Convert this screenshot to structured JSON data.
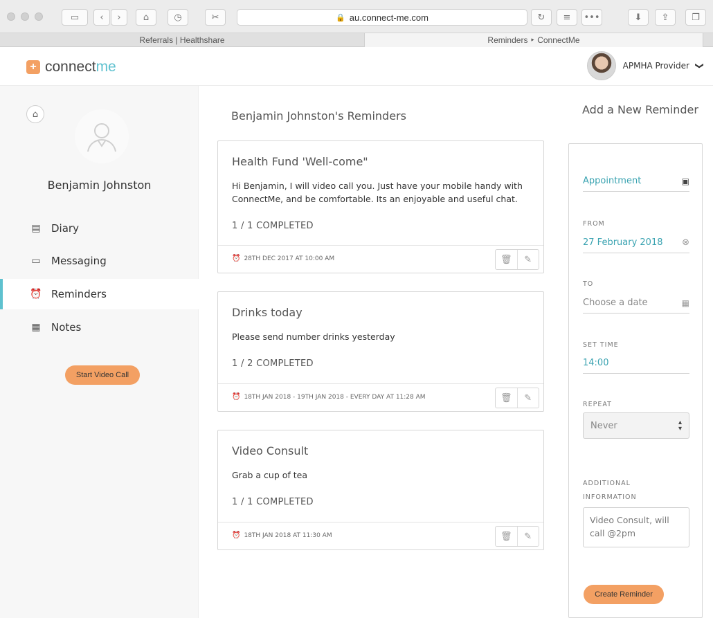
{
  "browser": {
    "url": "au.connect-me.com",
    "lock_icon": "lock-icon",
    "tabs": [
      {
        "label": "Referrals | Healthshare",
        "active": false
      },
      {
        "label": "Reminders ‣ ConnectMe",
        "active": true
      }
    ]
  },
  "header": {
    "logo_word1": "connect",
    "logo_word2": "me",
    "logo_symbol": "+",
    "user_name": "APMHA Provider",
    "chevron": "❯"
  },
  "sidebar": {
    "patient_name": "Benjamin Johnston",
    "items": [
      {
        "label": "Diary",
        "icon": "diary-icon"
      },
      {
        "label": "Messaging",
        "icon": "messaging-icon"
      },
      {
        "label": "Reminders",
        "icon": "alarm-clock-icon"
      },
      {
        "label": "Notes",
        "icon": "notes-icon"
      }
    ],
    "video_call_label": "Start Video Call"
  },
  "main": {
    "title": "Benjamin Johnston's Reminders",
    "reminders": [
      {
        "title": "Health Fund 'Well-come\"",
        "body": "Hi Benjamin, I will video call you. Just have your mobile handy with ConnectMe, and be comfortable. Its an enjoyable and useful chat.",
        "status": "1 / 1 COMPLETED",
        "schedule": "28TH DEC 2017 AT 10:00 AM"
      },
      {
        "title": "Drinks today",
        "body": "Please send number drinks yesterday",
        "status": "1 / 2 COMPLETED",
        "schedule": "18TH JAN 2018 - 19TH JAN 2018 - EVERY DAY AT 11:28 AM"
      },
      {
        "title": "Video Consult",
        "body": "Grab a cup of tea",
        "status": "1 / 1 COMPLETED",
        "schedule": "18TH JAN 2018 AT 11:30 AM"
      }
    ]
  },
  "form": {
    "title": "Add a New Reminder",
    "type_value": "Appointment",
    "from_label": "FROM",
    "from_value": "27 February 2018",
    "to_label": "TO",
    "to_placeholder": "Choose a date",
    "time_label": "SET TIME",
    "time_value": "14:00",
    "repeat_label": "REPEAT",
    "repeat_value": "Never",
    "info_label_line1": "ADDITIONAL",
    "info_label_line2": "INFORMATION",
    "info_value": "Video Consult, will call @2pm",
    "submit_label": "Create Reminder"
  },
  "colors": {
    "accent_teal": "#5ec1cf",
    "accent_orange": "#f3a063"
  }
}
